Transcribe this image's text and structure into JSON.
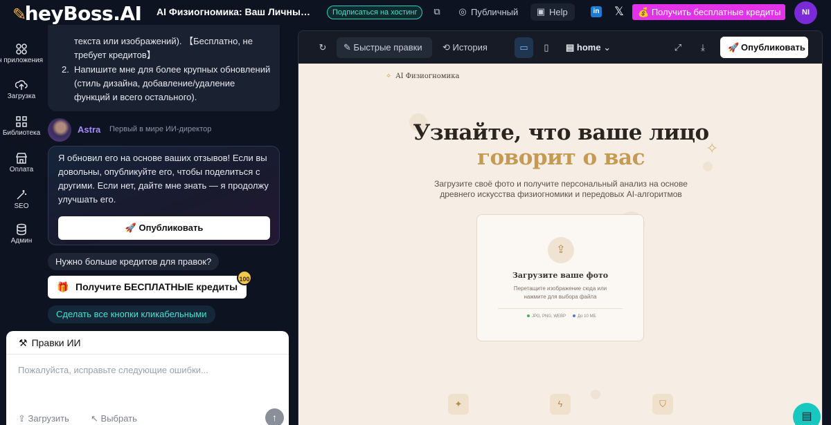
{
  "topbar": {
    "logo": "heyBoss.AI",
    "project_title": "AI Физиогномика: Ваш Личный Анализ",
    "subscribe_label": "Подписаться на хостинг",
    "public_label": "Публичный",
    "help_label": "Help",
    "credits_label": "Получить бесплатные кредиты",
    "avatar_initials": "NI",
    "accent_color": "#e233e8"
  },
  "rail": {
    "items": [
      {
        "label": "Дизайн приложения",
        "icon": "apps-icon"
      },
      {
        "label": "Загрузка",
        "icon": "cloud-upload-icon"
      },
      {
        "label": "Библиотека",
        "icon": "grid-icon"
      },
      {
        "label": "Оплата",
        "icon": "store-icon"
      },
      {
        "label": "SEO",
        "icon": "magic-wand-icon"
      },
      {
        "label": "Админ",
        "icon": "database-icon"
      }
    ]
  },
  "chat": {
    "prev_message": {
      "line1": "текста или изображений). 【Бесплатно, не",
      "line2": "требует кредитов】",
      "item2_num": "2.",
      "item2_line1": "Напишите мне для более крупных обновлений",
      "item2_line2": "(стиль дизайна, добавление/удаление",
      "item2_line3": "функций и всего остального)."
    },
    "assistant_name": "Astra",
    "assistant_role": "Первый в мире ИИ-директор",
    "reply": {
      "line1": "Я обновил его на основе ваших отзывов! Если вы",
      "line2": "довольны, опубликуйте его, чтобы поделиться с",
      "line3": "другими. Если нет, дайте мне знать — я продолжу",
      "line4": "улучшать его."
    },
    "publish_label": "Опубликовать",
    "need_more_credits": "Нужно больше кредитов для правок?",
    "free_credits_label": "Получите БЕСПЛАТНЫЕ кредиты",
    "free_badge": "100",
    "clickable_label": "Сделать все кнопки кликабельными"
  },
  "edits": {
    "title": "Правки ИИ",
    "placeholder": "Пожалуйста, исправьте следующие ошибки...",
    "upload_label": "Загрузить",
    "select_label": "Выбрать"
  },
  "preview": {
    "toolbar": {
      "quick_edits": "Быстрые правки",
      "history": "История",
      "page_select": "home",
      "publish": "Опубликовать"
    },
    "site": {
      "brand": "AI Физиогномика",
      "hero_line1": "Узнайте, что ваше лицо",
      "hero_line2": "говорит о вас",
      "subtitle_line1": "Загрузите своё фото и получите персональный анализ на основе",
      "subtitle_line2": "древнего искусства физиогномики и передовых AI-алгоритмов",
      "upload_title": "Загрузите ваше фото",
      "upload_hint1": "Перетащите изображение сюда или",
      "upload_hint2": "нажмите для выбора файла",
      "formats": "JPG, PNG, WEBP",
      "max_size": "До 10 МБ",
      "accent_color": "#c59a52",
      "background_color": "#f6eee5"
    }
  }
}
